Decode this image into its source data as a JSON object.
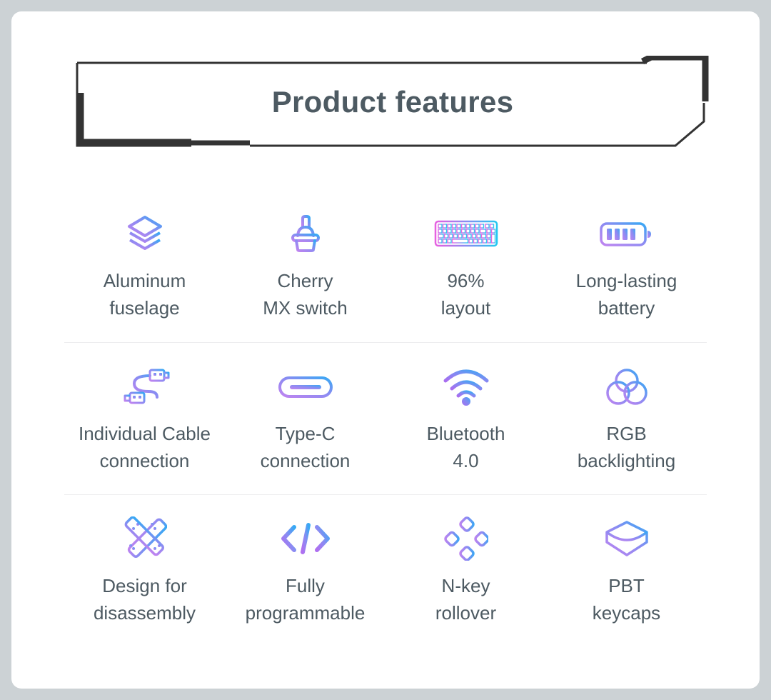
{
  "page": {
    "background_color": "#ccd2d5",
    "card_color": "#ffffff"
  },
  "header": {
    "title": "Product features",
    "title_color": "#4d5a62",
    "frame_color": "#333333"
  },
  "palette": {
    "gradient_start": "#c084f0",
    "gradient_mid": "#9b7ef0",
    "gradient_end": "#36a9f4",
    "keyboard_start": "#e75fe0",
    "keyboard_end": "#24c8f0",
    "divider": "#ededef",
    "text": "#4d5a62"
  },
  "features": {
    "rows": [
      {
        "cells": [
          {
            "icon": "layers-icon",
            "label": "Aluminum\nfuselage"
          },
          {
            "icon": "key-switch-icon",
            "label": "Cherry\nMX switch"
          },
          {
            "icon": "keyboard-icon",
            "label": "96%\nlayout"
          },
          {
            "icon": "battery-icon",
            "label": "Long-lasting\nbattery"
          }
        ]
      },
      {
        "cells": [
          {
            "icon": "cable-icon",
            "label": "Individual Cable\nconnection"
          },
          {
            "icon": "usb-c-port-icon",
            "label": "Type-C\nconnection"
          },
          {
            "icon": "wireless-signal-icon",
            "label": "Bluetooth\n4.0"
          },
          {
            "icon": "rgb-circles-icon",
            "label": "RGB\nbacklighting"
          }
        ]
      },
      {
        "cells": [
          {
            "icon": "crossed-plates-icon",
            "label": "Design for\ndisassembly"
          },
          {
            "icon": "code-brackets-icon",
            "label": "Fully\nprogrammable"
          },
          {
            "icon": "key-cluster-icon",
            "label": "N-key\nrollover"
          },
          {
            "icon": "keycap-3d-icon",
            "label": "PBT\nkeycaps"
          }
        ]
      }
    ]
  }
}
